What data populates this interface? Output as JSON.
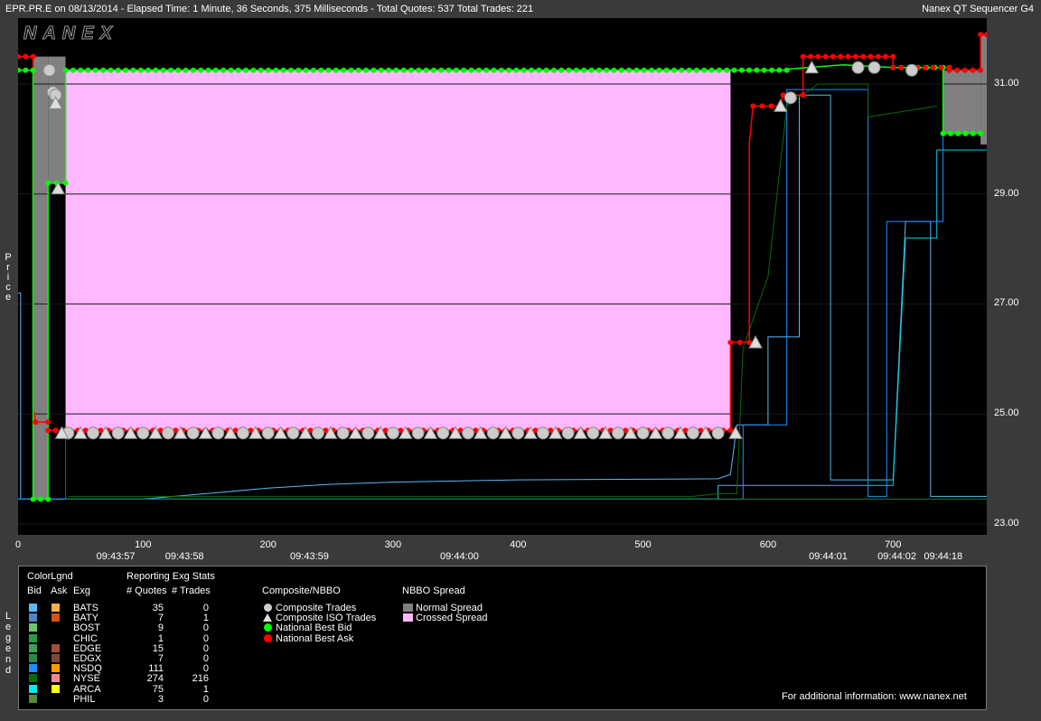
{
  "header": {
    "left": "EPR.PR.E on 08/13/2014  -  Elapsed Time: 1 Minute, 36 Seconds, 375 Milliseconds  -  Total Quotes: 537  Total Trades: 221",
    "right": "Nanex QT Sequencer G4"
  },
  "watermark": "NANEX",
  "chart_data": {
    "type": "line",
    "ylabel": "Price",
    "ylim": [
      22.8,
      32.2
    ],
    "xlim": [
      0,
      775
    ],
    "y_ticks": [
      "31.00",
      "29.00",
      "27.00",
      "25.00",
      "23.00"
    ],
    "y_tick_values": [
      31,
      29,
      27,
      25,
      23
    ],
    "x_ticks": [
      "0",
      "100",
      "200",
      "300",
      "400",
      "500",
      "600",
      "700"
    ],
    "x_tick_values": [
      0,
      100,
      200,
      300,
      400,
      500,
      600,
      700
    ],
    "time_labels": [
      "09:43:57",
      "09:43:58",
      "09:43:59",
      "09:44:00",
      "09:44:01",
      "09:44:02",
      "09:44:18"
    ],
    "time_label_positions": [
      80,
      135,
      235,
      355,
      650,
      705,
      742
    ],
    "national_best_bid": {
      "color": "#00ff00",
      "points": [
        [
          0,
          31.25
        ],
        [
          12,
          31.25
        ],
        [
          12,
          23.45
        ],
        [
          24,
          23.45
        ],
        [
          24,
          29.2
        ],
        [
          38,
          29.2
        ],
        [
          38,
          31.25
        ],
        [
          615,
          31.25
        ],
        [
          615,
          31.27
        ],
        [
          660,
          31.35
        ],
        [
          700,
          31.3
        ],
        [
          740,
          31.3
        ],
        [
          740,
          30.1
        ],
        [
          770,
          30.1
        ]
      ]
    },
    "national_best_ask": {
      "color": "#ff0000",
      "points": [
        [
          0,
          31.5
        ],
        [
          12,
          31.5
        ],
        [
          12,
          25.1
        ],
        [
          14,
          24.85
        ],
        [
          24,
          24.85
        ],
        [
          24,
          24.7
        ],
        [
          570,
          24.7
        ],
        [
          570,
          26.3
        ],
        [
          585,
          26.3
        ],
        [
          585,
          29.9
        ],
        [
          588,
          30.6
        ],
        [
          610,
          30.6
        ],
        [
          612,
          30.8
        ],
        [
          628,
          30.8
        ],
        [
          628,
          31.5
        ],
        [
          700,
          31.5
        ],
        [
          700,
          31.3
        ],
        [
          745,
          31.3
        ],
        [
          745,
          31.25
        ],
        [
          770,
          31.25
        ],
        [
          770,
          31.9
        ],
        [
          775,
          31.9
        ]
      ]
    },
    "normal_spread_bands": [
      [
        12,
        24,
        23.45,
        31.5
      ],
      [
        24,
        38,
        29.2,
        31.5
      ],
      [
        740,
        770,
        30.1,
        31.25
      ],
      [
        770,
        775,
        29.9,
        31.9
      ]
    ],
    "crossed_spread_band": [
      38,
      570,
      24.7,
      31.25
    ],
    "trade_markers_circle": [
      [
        25,
        31.25
      ],
      [
        28,
        30.85
      ],
      [
        30,
        30.8
      ],
      [
        40,
        24.65
      ],
      [
        60,
        24.65
      ],
      [
        80,
        24.65
      ],
      [
        100,
        24.65
      ],
      [
        120,
        24.65
      ],
      [
        140,
        24.65
      ],
      [
        160,
        24.65
      ],
      [
        180,
        24.65
      ],
      [
        200,
        24.65
      ],
      [
        220,
        24.65
      ],
      [
        240,
        24.65
      ],
      [
        260,
        24.65
      ],
      [
        280,
        24.65
      ],
      [
        300,
        24.65
      ],
      [
        320,
        24.65
      ],
      [
        340,
        24.65
      ],
      [
        360,
        24.65
      ],
      [
        380,
        24.65
      ],
      [
        400,
        24.65
      ],
      [
        420,
        24.65
      ],
      [
        440,
        24.65
      ],
      [
        460,
        24.65
      ],
      [
        480,
        24.65
      ],
      [
        500,
        24.65
      ],
      [
        520,
        24.65
      ],
      [
        540,
        24.65
      ],
      [
        560,
        24.65
      ],
      [
        618,
        30.75
      ],
      [
        672,
        31.3
      ],
      [
        685,
        31.3
      ],
      [
        715,
        31.25
      ]
    ],
    "trade_markers_iso": [
      [
        30,
        30.65
      ],
      [
        32,
        29.1
      ],
      [
        35,
        24.65
      ],
      [
        50,
        24.65
      ],
      [
        70,
        24.65
      ],
      [
        90,
        24.65
      ],
      [
        110,
        24.65
      ],
      [
        130,
        24.65
      ],
      [
        150,
        24.65
      ],
      [
        170,
        24.65
      ],
      [
        190,
        24.65
      ],
      [
        210,
        24.65
      ],
      [
        230,
        24.65
      ],
      [
        250,
        24.65
      ],
      [
        270,
        24.65
      ],
      [
        290,
        24.65
      ],
      [
        310,
        24.65
      ],
      [
        330,
        24.65
      ],
      [
        350,
        24.65
      ],
      [
        370,
        24.65
      ],
      [
        390,
        24.65
      ],
      [
        410,
        24.65
      ],
      [
        430,
        24.65
      ],
      [
        450,
        24.65
      ],
      [
        470,
        24.65
      ],
      [
        490,
        24.65
      ],
      [
        510,
        24.65
      ],
      [
        530,
        24.65
      ],
      [
        550,
        24.65
      ],
      [
        574,
        24.65
      ],
      [
        590,
        26.3
      ],
      [
        610,
        30.6
      ],
      [
        635,
        31.3
      ]
    ],
    "exchange_lines": [
      {
        "name": "BATS",
        "color": "#5bb8f5",
        "points": [
          [
            0,
            27.2
          ],
          [
            2,
            27.2
          ],
          [
            2,
            23.45
          ],
          [
            100,
            23.45
          ],
          [
            150,
            23.55
          ],
          [
            200,
            23.65
          ],
          [
            250,
            23.72
          ],
          [
            300,
            23.76
          ],
          [
            400,
            23.8
          ],
          [
            560,
            23.82
          ],
          [
            570,
            23.9
          ],
          [
            575,
            24.8
          ],
          [
            600,
            24.8
          ],
          [
            600,
            26.4
          ],
          [
            625,
            26.4
          ],
          [
            625,
            30.8
          ],
          [
            650,
            30.8
          ],
          [
            650,
            23.8
          ],
          [
            700,
            23.8
          ],
          [
            710,
            28.5
          ],
          [
            730,
            28.5
          ],
          [
            730,
            23.5
          ],
          [
            775,
            23.5
          ]
        ]
      },
      {
        "name": "ARCA",
        "color": "#00cfe0",
        "points": [
          [
            0,
            23.45
          ],
          [
            560,
            23.45
          ],
          [
            560,
            23.7
          ],
          [
            700,
            23.7
          ],
          [
            710,
            28.2
          ],
          [
            735,
            28.2
          ],
          [
            735,
            29.8
          ],
          [
            775,
            29.8
          ]
        ]
      },
      {
        "name": "NSDQ",
        "color": "#1f8fff",
        "points": [
          [
            0,
            23.45
          ],
          [
            580,
            23.45
          ],
          [
            580,
            24.8
          ],
          [
            615,
            24.8
          ],
          [
            615,
            30.9
          ],
          [
            680,
            30.9
          ],
          [
            680,
            23.5
          ],
          [
            695,
            23.5
          ],
          [
            695,
            28.5
          ],
          [
            740,
            28.5
          ],
          [
            740,
            30.2
          ]
        ]
      },
      {
        "name": "NYSE",
        "color": "#0a6a0a",
        "points": [
          [
            40,
            23.5
          ],
          [
            540,
            23.5
          ],
          [
            560,
            23.55
          ],
          [
            575,
            23.55
          ],
          [
            580,
            26.2
          ],
          [
            600,
            27.5
          ],
          [
            615,
            30.6
          ],
          [
            640,
            31.0
          ],
          [
            680,
            31.0
          ],
          [
            680,
            30.4
          ],
          [
            735,
            30.6
          ]
        ]
      },
      {
        "name": "EDGE",
        "color": "#1a7a3a",
        "points": [
          [
            38,
            24.7
          ],
          [
            38,
            23.45
          ],
          [
            775,
            23.45
          ]
        ]
      }
    ]
  },
  "legend": {
    "vertical_label": "Legend",
    "color_legend_title": "ColorLgnd",
    "col_bid": "Bid",
    "col_ask": "Ask",
    "col_exg": "Exg",
    "stats_title": "Reporting Exg Stats",
    "col_quotes": "# Quotes",
    "col_trades": "# Trades",
    "exchanges": [
      {
        "name": "BATS",
        "bid_color": "#5bb8f5",
        "ask_color": "#f5b04a",
        "quotes": "35",
        "trades": "0"
      },
      {
        "name": "BATY",
        "bid_color": "#4a86c8",
        "ask_color": "#d2521a",
        "quotes": "7",
        "trades": "1"
      },
      {
        "name": "BOST",
        "bid_color": "#6ac86a",
        "ask_color": "",
        "quotes": "9",
        "trades": "0"
      },
      {
        "name": "CHIC",
        "bid_color": "#2a9a4a",
        "ask_color": "",
        "quotes": "1",
        "trades": "0"
      },
      {
        "name": "EDGE",
        "bid_color": "#3aa05a",
        "ask_color": "#a0503a",
        "quotes": "15",
        "trades": "0"
      },
      {
        "name": "EDGX",
        "bid_color": "#2a8a4a",
        "ask_color": "#7a4a3a",
        "quotes": "7",
        "trades": "0"
      },
      {
        "name": "NSDQ",
        "bid_color": "#1f8fff",
        "ask_color": "#ff9a00",
        "quotes": "111",
        "trades": "0"
      },
      {
        "name": "NYSE",
        "bid_color": "#0a6a0a",
        "ask_color": "#f08a8a",
        "quotes": "274",
        "trades": "216"
      },
      {
        "name": "ARCA",
        "bid_color": "#00e8f0",
        "ask_color": "#ffff00",
        "quotes": "75",
        "trades": "1"
      },
      {
        "name": "PHIL",
        "bid_color": "#5a8a3a",
        "ask_color": "",
        "quotes": "3",
        "trades": "0"
      }
    ],
    "composite_title": "Composite/NBBO",
    "composite_items": [
      {
        "label": "Composite Trades",
        "icon": "circle",
        "color": "#cccccc"
      },
      {
        "label": "Composite ISO Trades",
        "icon": "triangle",
        "color": "#dddddd"
      },
      {
        "label": "National Best Bid",
        "icon": "circle",
        "color": "#00ff00"
      },
      {
        "label": "National Best Ask",
        "icon": "circle",
        "color": "#ff0000"
      }
    ],
    "spread_title": "NBBO Spread",
    "spread_items": [
      {
        "label": "Normal Spread",
        "color": "#808080"
      },
      {
        "label": "Crossed Spread",
        "color": "#ffb8ff"
      }
    ],
    "footer": "For additional information: www.nanex.net"
  }
}
